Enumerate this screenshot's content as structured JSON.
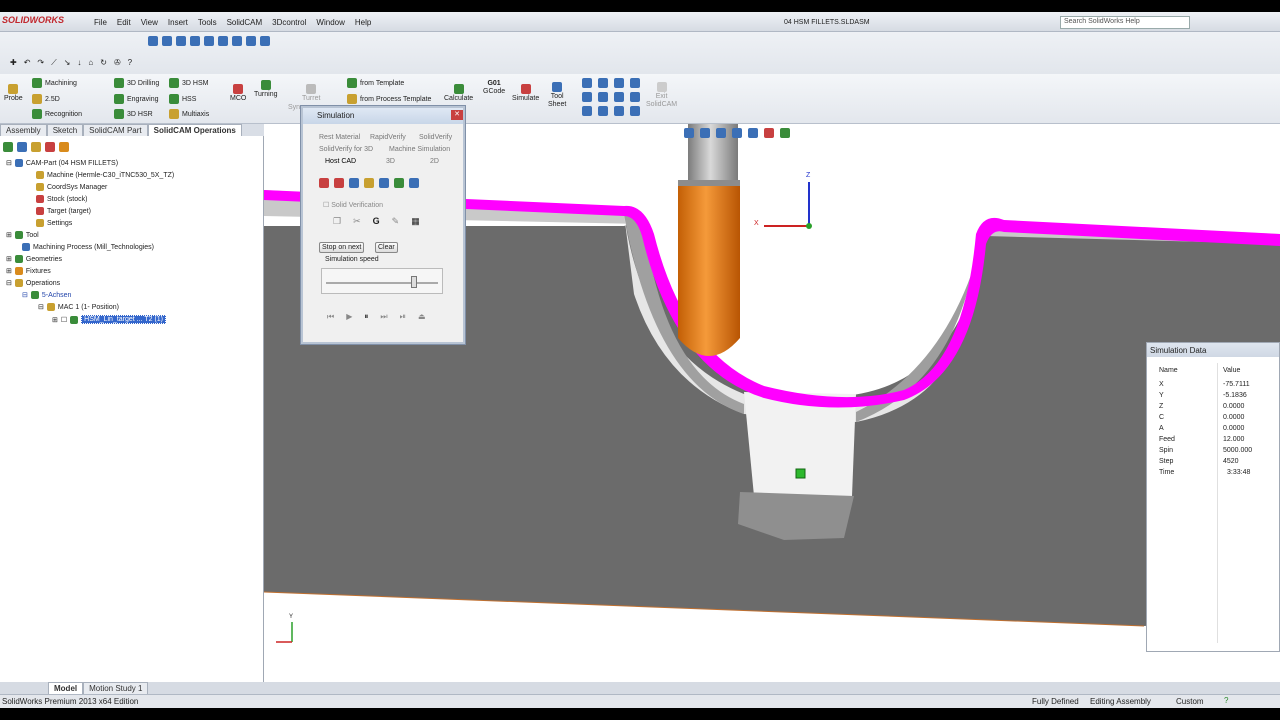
{
  "app": {
    "logo": "SOLIDWORKS",
    "doc_title": "04 HSM FILLETS.SLDASM",
    "search_placeholder": "Search SolidWorks Help"
  },
  "menu": [
    "File",
    "Edit",
    "View",
    "Insert",
    "Tools",
    "SolidCAM",
    "3Dcontrol",
    "Window",
    "Help"
  ],
  "ribbon": {
    "probe": "Probe",
    "machining": "Machining",
    "d25": "2.5D",
    "recognition": "Recognition",
    "drilling": "3D Drilling",
    "engraving": "Engraving",
    "hsr": "3D HSR",
    "hsm": "3D HSM",
    "hss": "HSS",
    "multiaxis": "Multiaxis",
    "mco": "MCO",
    "turning": "Turning",
    "turret": "Turret",
    "sync": "Syn",
    "from_template": "from Template",
    "from_process_template": "from Process Template",
    "calculate": "Calculate",
    "gcode_num": "G01",
    "gcode": "GCode",
    "simulate": "Simulate",
    "tool_sheet_1": "Tool",
    "tool_sheet_2": "Sheet",
    "exit_1": "Exit",
    "exit_2": "SolidCAM"
  },
  "panel_tabs": [
    "Assembly",
    "Sketch",
    "SolidCAM Part",
    "SolidCAM Operations"
  ],
  "tree": [
    "CAM-Part (04 HSM FILLETS)",
    "Machine (Hermle-C30_iTNC530_5X_TZ)",
    "CoordSys Manager",
    "Stock (stock)",
    "Target (target)",
    "Settings",
    "Tool",
    "Machining Process (Mill_Technologies)",
    "Geometries",
    "Fixtures",
    "Operations",
    "5-Achsen",
    "MAC 1 (1- Position)",
    "HSM_Lin_target ... T2 (1)"
  ],
  "simulation": {
    "title": "Simulation",
    "tabs_row1": [
      "Rest Material",
      "RapidVerify",
      "SolidVerify"
    ],
    "tabs_row2": [
      "SolidVerify for 3D",
      "Machine Simulation"
    ],
    "tabs_row3": [
      "Host CAD",
      "3D",
      "2D"
    ],
    "solid_verification": "Solid Verification",
    "stop_on_next": "Stop on next",
    "clear": "Clear",
    "speed_label": "Simulation speed",
    "speed": 0.8
  },
  "sim_data": {
    "title": "Simulation Data",
    "col_name": "Name",
    "col_value": "Value",
    "rows": [
      {
        "name": "X",
        "value": "-75.7111"
      },
      {
        "name": "Y",
        "value": "-5.1836"
      },
      {
        "name": "Z",
        "value": "0.0000"
      },
      {
        "name": "C",
        "value": "0.0000"
      },
      {
        "name": "A",
        "value": "0.0000"
      },
      {
        "name": "Feed",
        "value": "12.000"
      },
      {
        "name": "Spin",
        "value": "5000.000"
      },
      {
        "name": "Step",
        "value": "4520"
      },
      {
        "name": "Time",
        "value": "3:33:48"
      }
    ]
  },
  "axes": {
    "x": "X",
    "y": "Y",
    "z": "Z"
  },
  "bottom_tabs": [
    "Model",
    "Motion Study 1"
  ],
  "status": {
    "edition": "SolidWorks Premium 2013 x64 Edition",
    "defined": "Fully Defined",
    "editing": "Editing Assembly",
    "units": "Custom"
  },
  "colors": {
    "toolpath": "#ff00ff",
    "tool_body": "#f07f12",
    "part": "#6b6b6b"
  }
}
